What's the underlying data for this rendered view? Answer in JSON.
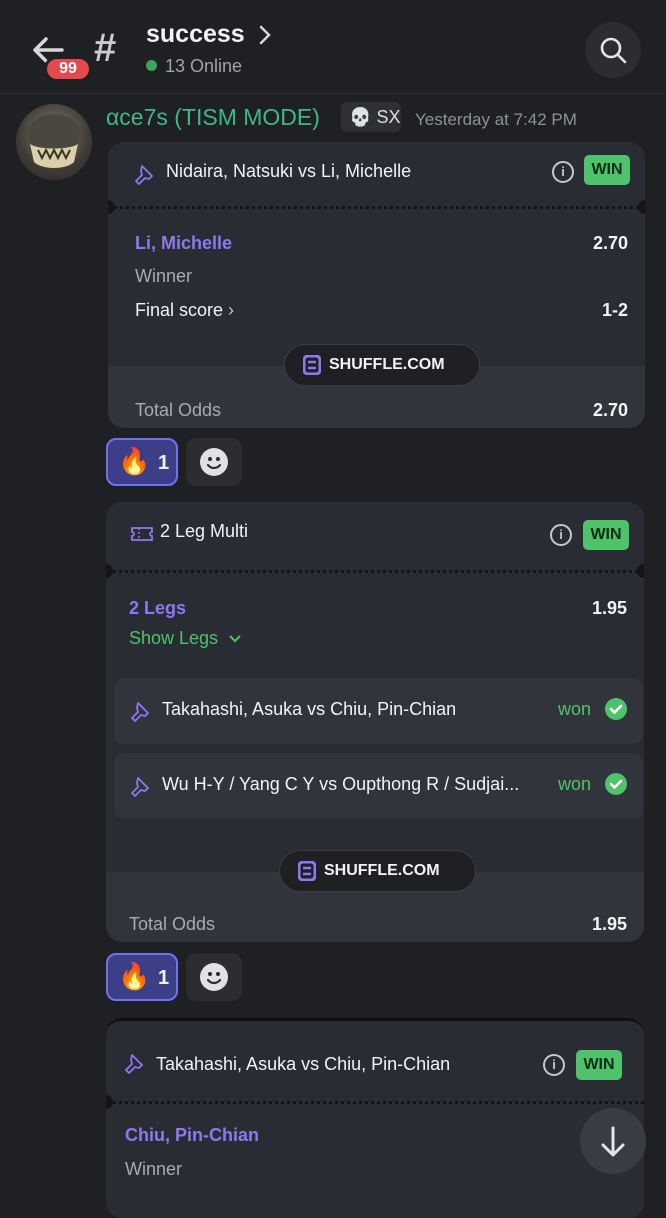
{
  "header": {
    "unread_badge": "99",
    "channel_name": "success",
    "online_text": "13 Online"
  },
  "message": {
    "username": "αce7s (TISM MODE)",
    "tag": "SX",
    "timestamp": "Yesterday at 7:42 PM"
  },
  "bet1": {
    "title": "Nidaira, Natsuki vs Li, Michelle",
    "status": "WIN",
    "selection": "Li, Michelle",
    "odds": "2.70",
    "market": "Winner",
    "final_score_label": "Final score",
    "final_score": "1-2",
    "brand": "SHUFFLE.COM",
    "total_odds_label": "Total Odds",
    "total_odds": "2.70"
  },
  "reaction1": {
    "emoji": "🔥",
    "count": "1"
  },
  "bet2": {
    "title": "2 Leg Multi",
    "status": "WIN",
    "legs_label": "2 Legs",
    "odds": "1.95",
    "show_legs": "Show Legs",
    "legs": [
      {
        "title": "Takahashi, Asuka vs Chiu, Pin-Chian",
        "result": "won"
      },
      {
        "title": "Wu H-Y / Yang C Y vs Oupthong R / Sudjai...",
        "result": "won"
      }
    ],
    "brand": "SHUFFLE.COM",
    "total_odds_label": "Total Odds",
    "total_odds": "1.95"
  },
  "reaction2": {
    "emoji": "🔥",
    "count": "1"
  },
  "bet3": {
    "title": "Takahashi, Asuka vs Chiu, Pin-Chian",
    "status": "WIN",
    "selection": "Chiu, Pin-Chian",
    "market": "Winner"
  },
  "colors": {
    "accent_purple": "#8e78f0",
    "win_green": "#4fc36b",
    "username_green": "#3fb68b",
    "badge_red": "#e5484d"
  }
}
